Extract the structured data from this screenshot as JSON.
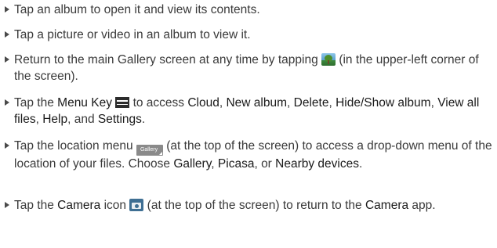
{
  "items": [
    {
      "text": "Tap an album to open it and view its contents."
    },
    {
      "text": "Tap a picture or video in an album to view it."
    },
    {
      "before": "Return to the main Gallery screen at any time by tapping ",
      "icon": "gallery-icon",
      "after": " (in the upper-left corner of the screen)."
    },
    {
      "p1": "Tap the ",
      "menu_key": "Menu Key",
      "icon": "menu-key-icon",
      "p2": " to access ",
      "cloud": "Cloud",
      "p3": ", ",
      "new_album": "New album",
      "p4": ", ",
      "delete": "Delete",
      "p5": ", ",
      "hide_show": "Hide/Show album",
      "p6": ", ",
      "view_all": "View all files",
      "p7": ", ",
      "help": "Help",
      "p8": ", and ",
      "settings": "Settings",
      "p9": "."
    },
    {
      "p1": "Tap the location menu ",
      "icon_label": "Gallery",
      "p2": " (at the top of the screen) to access a drop-down menu of the location of your files. Choose ",
      "gallery": "Gallery",
      "p3": ", ",
      "picasa": "Picasa",
      "p4": ", or ",
      "nearby": "Nearby devices",
      "p5": "."
    },
    {
      "p1": "Tap the ",
      "camera": "Camera",
      "p2": " icon ",
      "icon": "camera-icon",
      "p3": " (at the top of the screen) to return to the ",
      "camera_app": "Camera",
      "p4": " app."
    }
  ]
}
